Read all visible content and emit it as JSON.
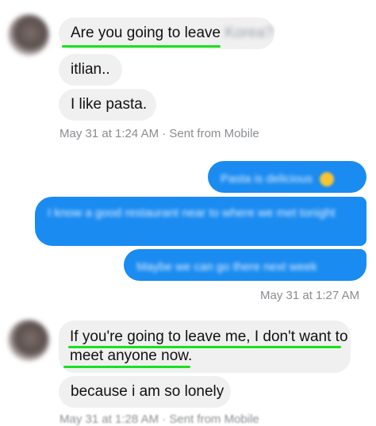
{
  "messages_top": {
    "msg1_text": "Are you going to leave",
    "msg1_hidden": "Korea?",
    "msg2_text": "itlian..",
    "msg3_text": "I like pasta.",
    "meta_text": "May 31 at 1:24 AM · Sent from Mobile"
  },
  "messages_out": {
    "msg1_text": "Pasta is delicious",
    "msg2_text": "I know a good restaurant near to where we met tonight",
    "msg3_text": "Maybe we can go there next week",
    "meta_text": "May 31 at 1:27 AM"
  },
  "messages_bottom": {
    "msg1_line1": "If you're going to leave me, I don't want to",
    "msg1_line2": "meet anyone now.",
    "msg2_text": "because i am so lonely",
    "meta_text": "May 31 at 1:28 AM · Sent from Mobile"
  },
  "colors": {
    "incoming_bubble": "#f0f0f1",
    "outgoing_bubble": "#1a8bf0",
    "highlight_underline": "#19e01e",
    "meta_text": "#8a8d91"
  },
  "icons": {
    "emoji": "smile-emoji-icon"
  }
}
